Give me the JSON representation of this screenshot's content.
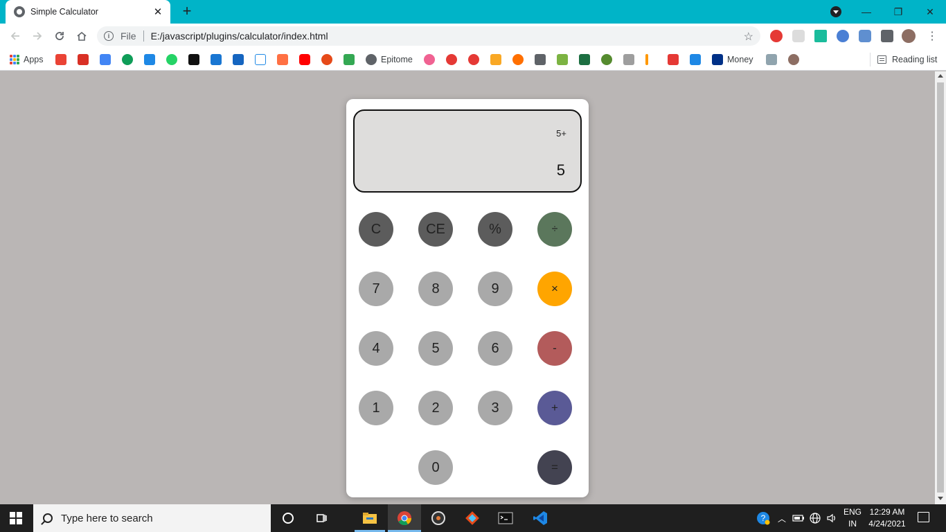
{
  "browser": {
    "tab_title": "Simple Calculator",
    "tab_close": "✕",
    "new_tab": "+",
    "window_controls": {
      "minimize": "—",
      "restore": "❐",
      "close": "✕"
    },
    "omnibox": {
      "scheme_label": "File",
      "url": "E:/javascript/plugins/calculator/index.html"
    },
    "bookmarks": {
      "apps_label": "Apps",
      "epitome_label": "Epitome",
      "money_label": "Money",
      "reading_list_label": "Reading list"
    }
  },
  "calculator": {
    "display": {
      "previous": "5+",
      "current": "5"
    },
    "keys": {
      "clear": "C",
      "clear_entry": "CE",
      "percent": "%",
      "divide": "÷",
      "seven": "7",
      "eight": "8",
      "nine": "9",
      "multiply": "×",
      "four": "4",
      "five": "5",
      "six": "6",
      "subtract": "-",
      "one": "1",
      "two": "2",
      "three": "3",
      "add": "+",
      "zero": "0",
      "equals": "="
    },
    "colors": {
      "function_key": "#5c5c5c",
      "number_key": "#a9a9a9",
      "divide_key": "#5b775c",
      "multiply_key": "#ffa500",
      "subtract_key": "#b35b5b",
      "add_key": "#5a5a96",
      "equals_key": "#434351",
      "display_bg": "#dedddc",
      "page_bg": "#bab6b5"
    }
  },
  "taskbar": {
    "search_placeholder": "Type here to search",
    "language": {
      "line1": "ENG",
      "line2": "IN"
    },
    "clock": {
      "time": "12:29 AM",
      "date": "4/24/2021"
    }
  }
}
